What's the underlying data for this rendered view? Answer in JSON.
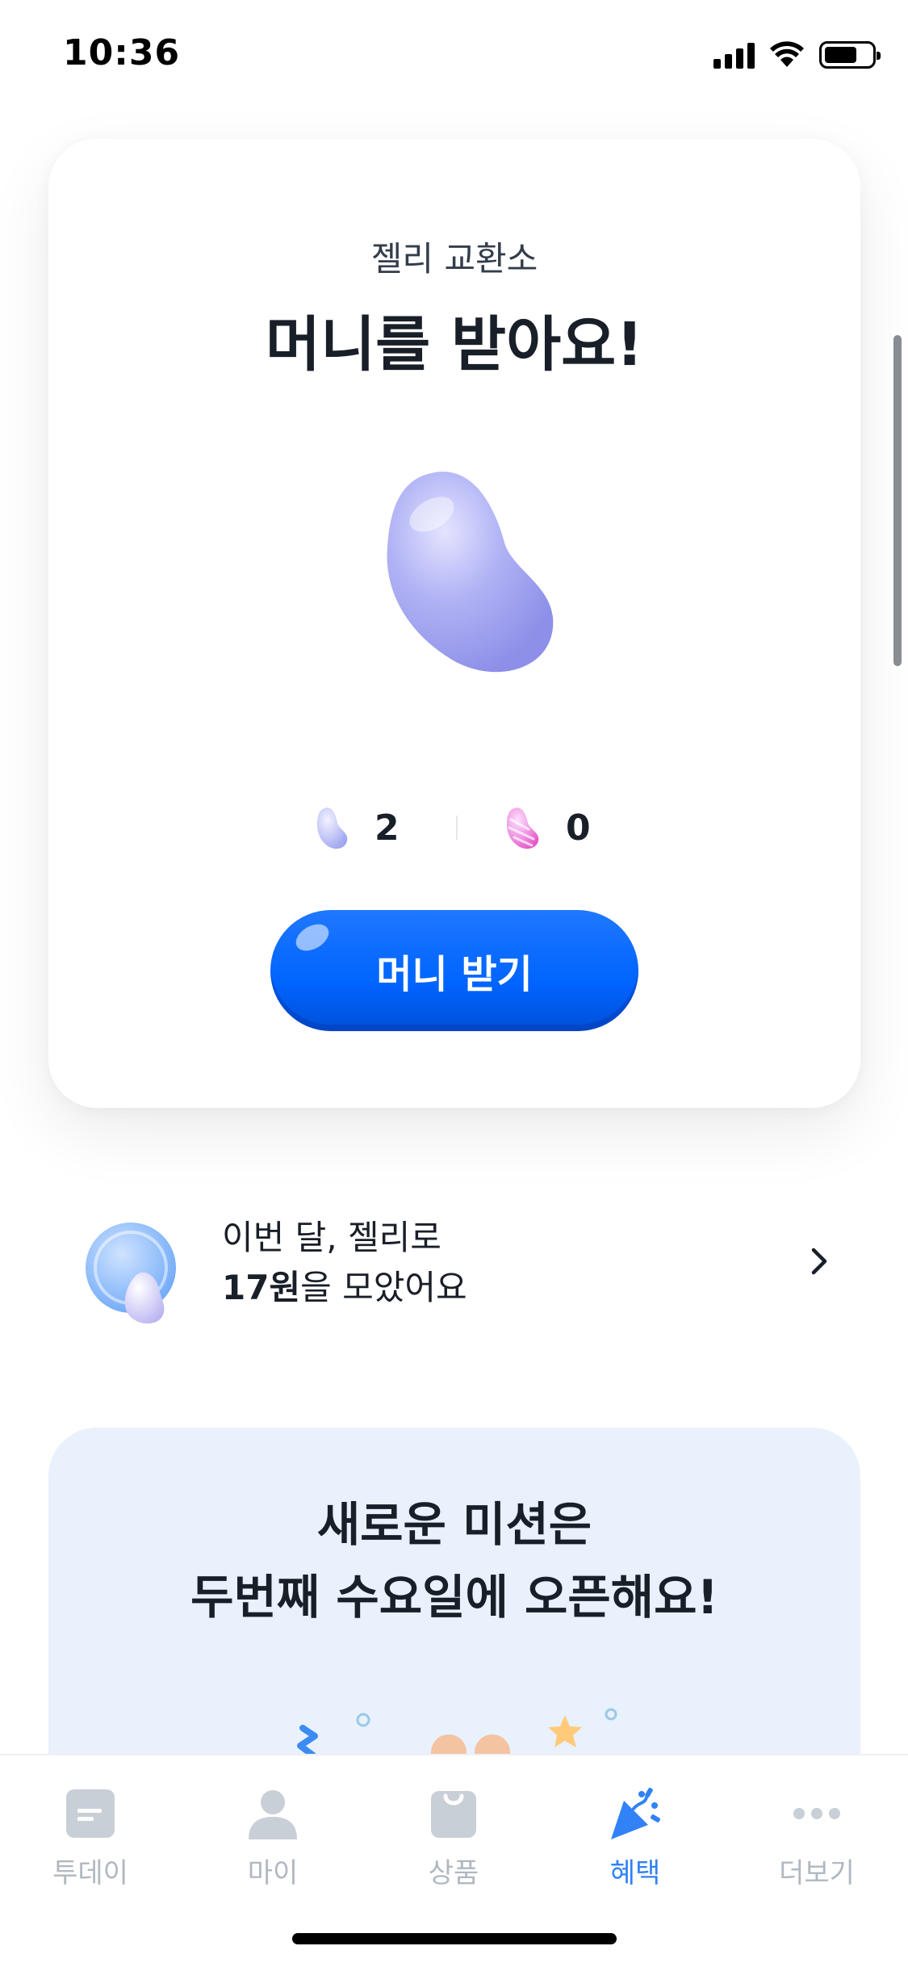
{
  "status_bar": {
    "time": "10:36"
  },
  "exchange": {
    "subtitle": "젤리 교환소",
    "title": "머니를 받아요!",
    "blue_jelly_count": "2",
    "pink_jelly_count": "0",
    "button_label": "머니 받기"
  },
  "monthly": {
    "line1": "이번 달, 젤리로",
    "amount": "17원",
    "line2_suffix": "을 모았어요"
  },
  "mission": {
    "line1": "새로운 미션은",
    "line2": "두번째 수요일에 오픈해요!"
  },
  "tabs": [
    {
      "label": "투데이",
      "icon": "today-icon"
    },
    {
      "label": "마이",
      "icon": "person-icon"
    },
    {
      "label": "상품",
      "icon": "shopping-bag-icon"
    },
    {
      "label": "혜택",
      "icon": "party-popper-icon",
      "active": true
    },
    {
      "label": "더보기",
      "icon": "more-dots-icon"
    }
  ],
  "colors": {
    "primary": "#0064ff",
    "tab_active": "#3182f6",
    "tab_inactive": "#b0b8c1",
    "mission_bg": "#e9f1fd",
    "jelly": "#a9a9f5"
  }
}
